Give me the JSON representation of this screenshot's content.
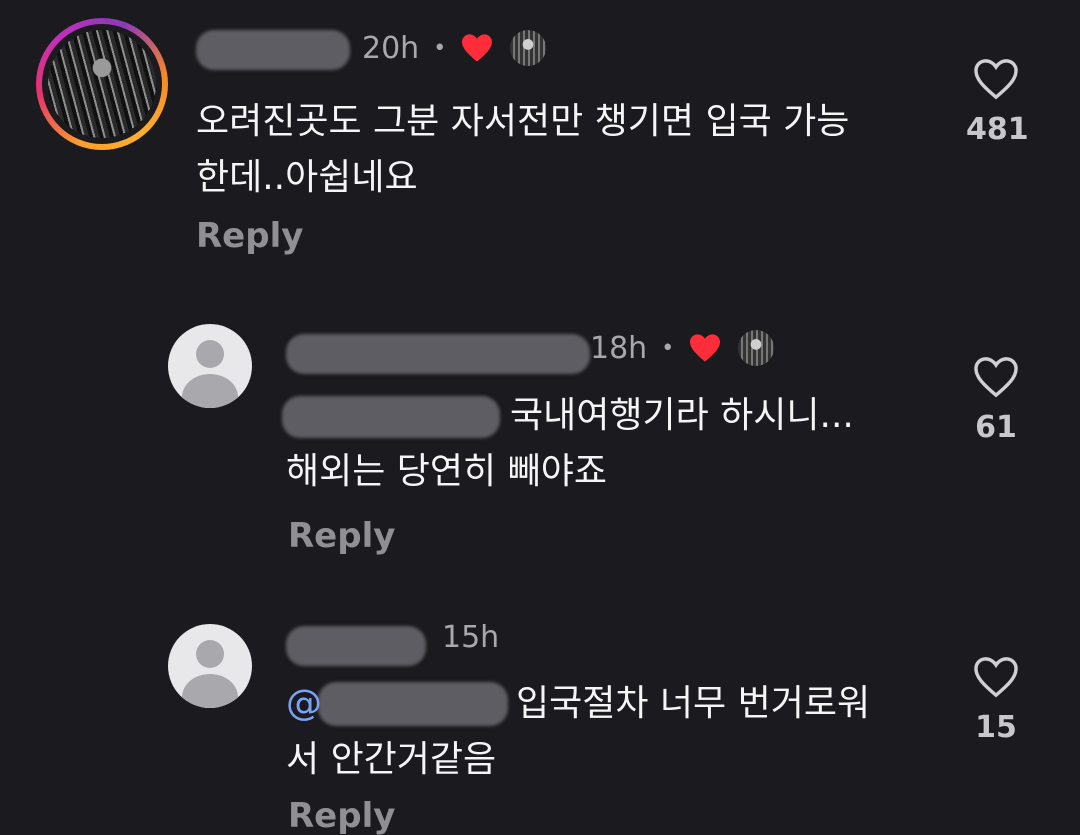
{
  "comments": [
    {
      "time": "20h",
      "text_line1": "오려진곳도 그분 자서전만 챙기면 입국 가능",
      "text_line2": "한데..아쉽네요",
      "reply_label": "Reply",
      "likes": "481",
      "liked_by_author": true
    },
    {
      "time": "18h",
      "text_line1": "국내여행기라 하시니...",
      "text_line2": "해외는 당연히 빼야죠",
      "reply_label": "Reply",
      "likes": "61",
      "liked_by_author": true
    },
    {
      "time": "15h",
      "mention_visible": "@",
      "text_line1": "입국절차 너무 번거로워",
      "text_line2": "서 안간거같음",
      "reply_label": "Reply",
      "likes": "15",
      "liked_by_author": false
    }
  ],
  "icons": {
    "like": "heart-outline-icon",
    "author_like": "heart-filled-icon",
    "dot": "•"
  },
  "colors": {
    "background": "#1b1b1f",
    "author_heart": "#ff2d3a",
    "mention": "#7aa2f7"
  }
}
